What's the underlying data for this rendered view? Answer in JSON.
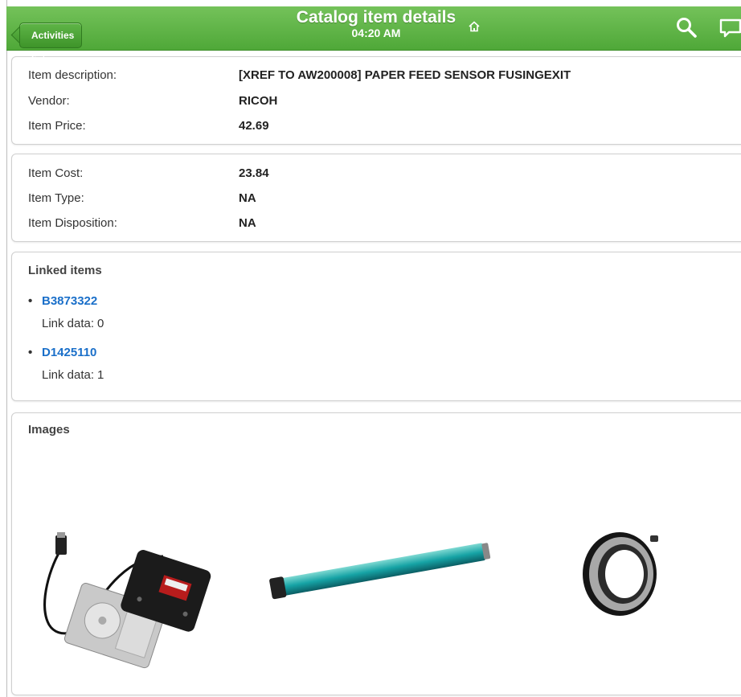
{
  "header": {
    "back_label": "Activities list",
    "title": "Catalog item details",
    "time": "04:20 AM",
    "icons": [
      "home-icon",
      "search-icon",
      "chat-icon"
    ],
    "color": "#5cb544"
  },
  "details": [
    {
      "label": "Item description:",
      "value": "[XREF TO AW200008] PAPER FEED SENSOR FUSINGEXIT"
    },
    {
      "label": "Vendor:",
      "value": "RICOH"
    },
    {
      "label": "Item Price:",
      "value": "42.69"
    }
  ],
  "costs": [
    {
      "label": "Item Cost:",
      "value": "23.84"
    },
    {
      "label": "Item Type:",
      "value": "NA"
    },
    {
      "label": "Item Disposition:",
      "value": "NA"
    }
  ],
  "linked": {
    "title": "Linked items",
    "link_data_label": "Link data:",
    "items": [
      {
        "id": "B3873322",
        "link_data": "0"
      },
      {
        "id": "D1425110",
        "link_data": "1"
      }
    ],
    "link_color": "#1a6fc9"
  },
  "images": {
    "title": "Images"
  }
}
